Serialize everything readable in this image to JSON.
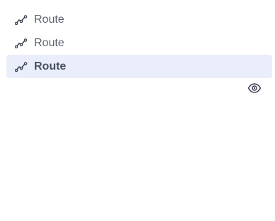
{
  "items": [
    {
      "label": "Route",
      "icon": "route-icon",
      "selected": false
    },
    {
      "label": "Route",
      "icon": "route-icon",
      "selected": false
    },
    {
      "label": "Route",
      "icon": "route-icon",
      "selected": true
    }
  ],
  "visibility_toggle": {
    "icon": "eye-icon"
  },
  "colors": {
    "selected_bg": "#e9eefa",
    "text": "#5b6170",
    "icon": "#3c4250"
  }
}
